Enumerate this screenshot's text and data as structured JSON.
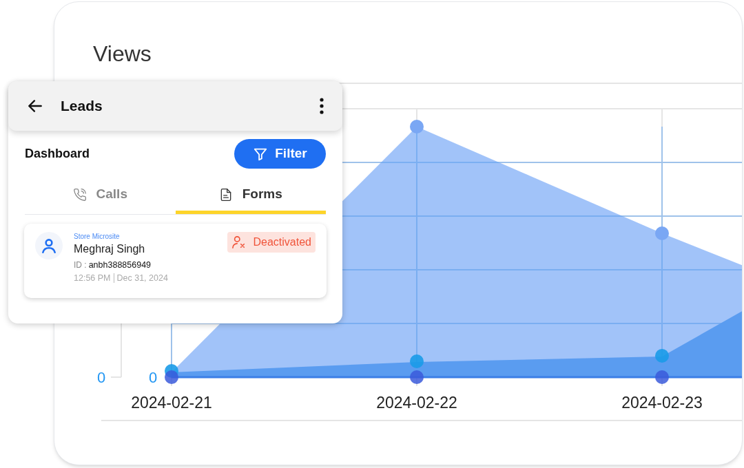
{
  "title": "Views",
  "chart": {
    "y_ticks": [
      {
        "label": "0"
      },
      {
        "label": "0"
      }
    ],
    "x_labels": [
      "2024-02-21",
      "2024-02-22",
      "2024-02-23"
    ]
  },
  "panel": {
    "title": "Leads",
    "section": "Dashboard",
    "filter_button": "Filter",
    "tabs": [
      {
        "label": "Calls",
        "kind": "calls",
        "selected": false
      },
      {
        "label": "Forms",
        "kind": "forms",
        "selected": true
      }
    ],
    "leads": [
      {
        "source": "Store Microsite",
        "name": "Meghraj Singh",
        "id_label": "ID :",
        "id_value": "anbh388856949",
        "time": "12:56 PM",
        "date": "Dec 31, 2024",
        "status": "Deactivated",
        "active": false
      }
    ]
  }
}
